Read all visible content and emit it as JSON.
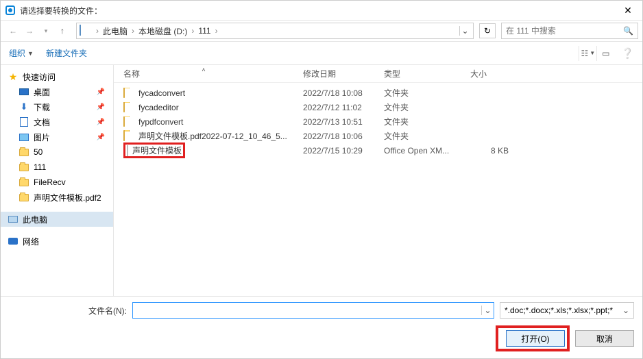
{
  "title": "请选择要转换的文件：",
  "breadcrumb": {
    "root_icon": "pc",
    "items": [
      "此电脑",
      "本地磁盘 (D:)",
      "111"
    ]
  },
  "search": {
    "placeholder": "在 111 中搜索"
  },
  "toolbar": {
    "organize": "组织",
    "new_folder": "新建文件夹"
  },
  "sidebar": {
    "quick_access": "快速访问",
    "items_pinned": [
      {
        "label": "桌面",
        "icon": "desktop"
      },
      {
        "label": "下载",
        "icon": "down"
      },
      {
        "label": "文档",
        "icon": "docfolder"
      },
      {
        "label": "图片",
        "icon": "pic"
      }
    ],
    "items_recent": [
      {
        "label": "50",
        "icon": "folder"
      },
      {
        "label": "111",
        "icon": "folder"
      },
      {
        "label": "FileRecv",
        "icon": "folder"
      },
      {
        "label": "声明文件模板.pdf2",
        "icon": "folder"
      }
    ],
    "this_pc": "此电脑",
    "network": "网络"
  },
  "columns": {
    "name": "名称",
    "date": "修改日期",
    "type": "类型",
    "size": "大小"
  },
  "files": [
    {
      "name": "fycadconvert",
      "date": "2022/7/18 10:08",
      "type": "文件夹",
      "size": "",
      "icon": "folder"
    },
    {
      "name": "fycadeditor",
      "date": "2022/7/12 11:02",
      "type": "文件夹",
      "size": "",
      "icon": "folder"
    },
    {
      "name": "fypdfconvert",
      "date": "2022/7/13 10:51",
      "type": "文件夹",
      "size": "",
      "icon": "folder"
    },
    {
      "name": "声明文件模板.pdf2022-07-12_10_46_5...",
      "date": "2022/7/18 10:06",
      "type": "文件夹",
      "size": "",
      "icon": "folder"
    },
    {
      "name": "声明文件模板",
      "date": "2022/7/15 10:29",
      "type": "Office Open XM...",
      "size": "8 KB",
      "icon": "doc",
      "highlight": true
    }
  ],
  "bottom": {
    "filename_label": "文件名(N):",
    "filename_value": "",
    "filter": "*.doc;*.docx;*.xls;*.xlsx;*.ppt;*",
    "open": "打开(O)",
    "cancel": "取消"
  }
}
